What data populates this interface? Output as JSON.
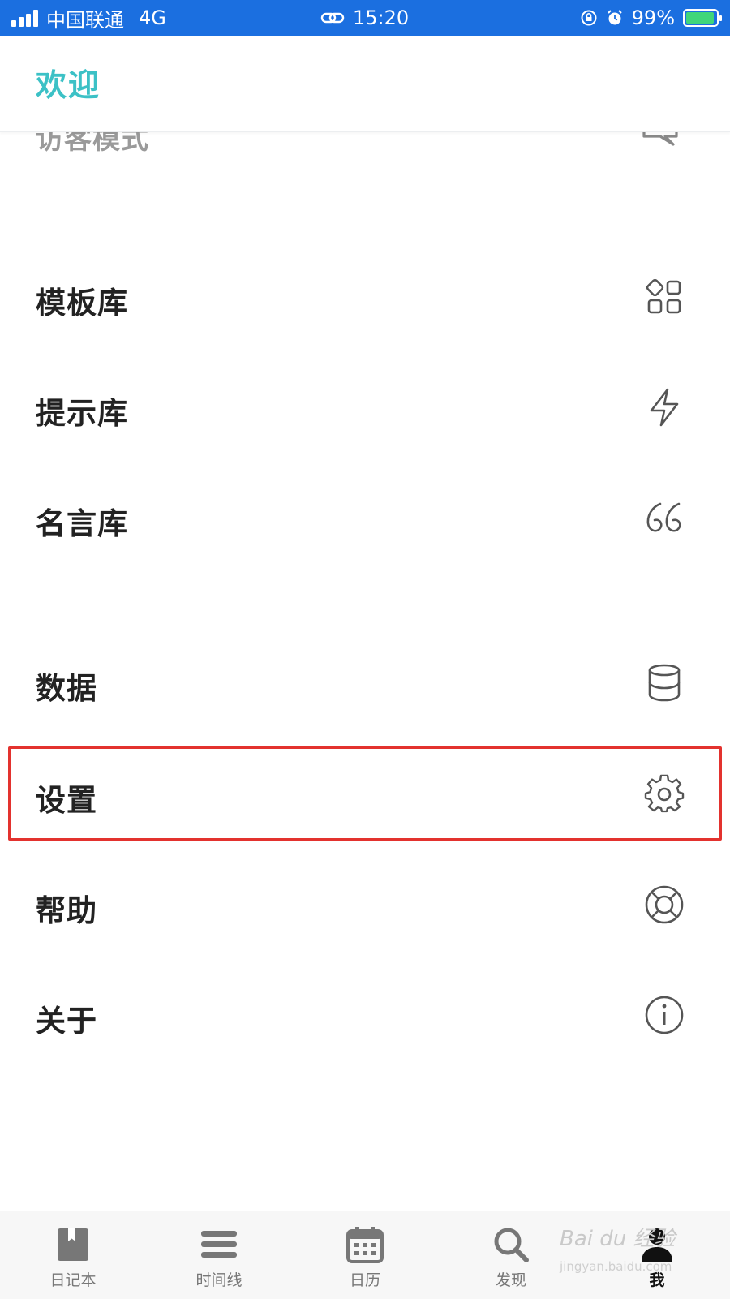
{
  "status_bar": {
    "carrier": "中国联通",
    "network": "4G",
    "time": "15:20",
    "battery": "99%",
    "icons": [
      "signal-icon",
      "link-icon",
      "rotation-lock-icon",
      "alarm-icon",
      "battery-charging-icon"
    ]
  },
  "header": {
    "title": "欢迎"
  },
  "partial_row": {
    "label": "访客模式",
    "icon": "chat-icon"
  },
  "menu": [
    {
      "label": "模板库",
      "icon": "grid-icon"
    },
    {
      "label": "提示库",
      "icon": "lightning-icon"
    },
    {
      "label": "名言库",
      "icon": "quote-icon"
    },
    {
      "label": "数据",
      "icon": "database-icon"
    },
    {
      "label": "设置",
      "icon": "gear-icon"
    },
    {
      "label": "帮助",
      "icon": "lifebuoy-icon"
    },
    {
      "label": "关于",
      "icon": "info-icon"
    }
  ],
  "tabs": [
    {
      "label": "日记本",
      "icon": "notebook-icon"
    },
    {
      "label": "时间线",
      "icon": "timeline-icon"
    },
    {
      "label": "日历",
      "icon": "calendar-icon"
    },
    {
      "label": "发现",
      "icon": "search-icon"
    },
    {
      "label": "我",
      "icon": "user-icon",
      "active": true
    }
  ],
  "colors": {
    "accent": "#3cc1c6",
    "status_bar": "#1b6fe0",
    "highlight": "#e3322e"
  },
  "watermark": {
    "text": "Bai du 经验",
    "sub": "jingyan.baidu.com"
  }
}
